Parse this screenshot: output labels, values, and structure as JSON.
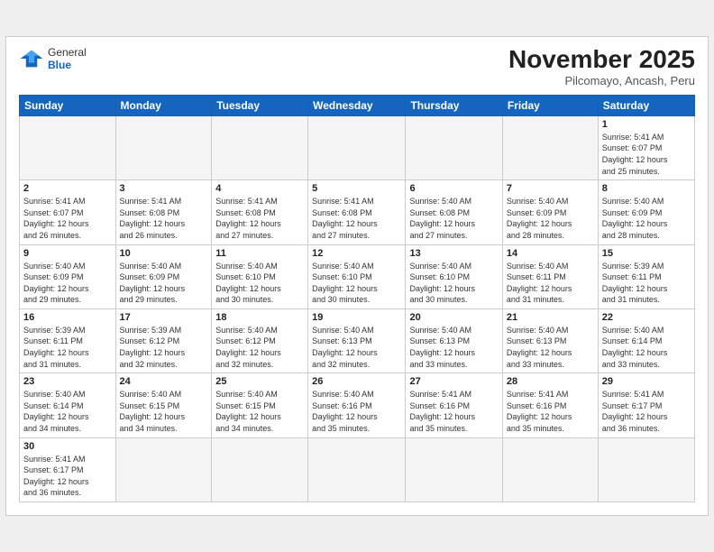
{
  "header": {
    "logo_general": "General",
    "logo_blue": "Blue",
    "month_title": "November 2025",
    "subtitle": "Pilcomayo, Ancash, Peru"
  },
  "weekdays": [
    "Sunday",
    "Monday",
    "Tuesday",
    "Wednesday",
    "Thursday",
    "Friday",
    "Saturday"
  ],
  "weeks": [
    [
      {
        "day": "",
        "info": ""
      },
      {
        "day": "",
        "info": ""
      },
      {
        "day": "",
        "info": ""
      },
      {
        "day": "",
        "info": ""
      },
      {
        "day": "",
        "info": ""
      },
      {
        "day": "",
        "info": ""
      },
      {
        "day": "1",
        "info": "Sunrise: 5:41 AM\nSunset: 6:07 PM\nDaylight: 12 hours\nand 25 minutes."
      }
    ],
    [
      {
        "day": "2",
        "info": "Sunrise: 5:41 AM\nSunset: 6:07 PM\nDaylight: 12 hours\nand 26 minutes."
      },
      {
        "day": "3",
        "info": "Sunrise: 5:41 AM\nSunset: 6:08 PM\nDaylight: 12 hours\nand 26 minutes."
      },
      {
        "day": "4",
        "info": "Sunrise: 5:41 AM\nSunset: 6:08 PM\nDaylight: 12 hours\nand 27 minutes."
      },
      {
        "day": "5",
        "info": "Sunrise: 5:41 AM\nSunset: 6:08 PM\nDaylight: 12 hours\nand 27 minutes."
      },
      {
        "day": "6",
        "info": "Sunrise: 5:40 AM\nSunset: 6:08 PM\nDaylight: 12 hours\nand 27 minutes."
      },
      {
        "day": "7",
        "info": "Sunrise: 5:40 AM\nSunset: 6:09 PM\nDaylight: 12 hours\nand 28 minutes."
      },
      {
        "day": "8",
        "info": "Sunrise: 5:40 AM\nSunset: 6:09 PM\nDaylight: 12 hours\nand 28 minutes."
      }
    ],
    [
      {
        "day": "9",
        "info": "Sunrise: 5:40 AM\nSunset: 6:09 PM\nDaylight: 12 hours\nand 29 minutes."
      },
      {
        "day": "10",
        "info": "Sunrise: 5:40 AM\nSunset: 6:09 PM\nDaylight: 12 hours\nand 29 minutes."
      },
      {
        "day": "11",
        "info": "Sunrise: 5:40 AM\nSunset: 6:10 PM\nDaylight: 12 hours\nand 30 minutes."
      },
      {
        "day": "12",
        "info": "Sunrise: 5:40 AM\nSunset: 6:10 PM\nDaylight: 12 hours\nand 30 minutes."
      },
      {
        "day": "13",
        "info": "Sunrise: 5:40 AM\nSunset: 6:10 PM\nDaylight: 12 hours\nand 30 minutes."
      },
      {
        "day": "14",
        "info": "Sunrise: 5:40 AM\nSunset: 6:11 PM\nDaylight: 12 hours\nand 31 minutes."
      },
      {
        "day": "15",
        "info": "Sunrise: 5:39 AM\nSunset: 6:11 PM\nDaylight: 12 hours\nand 31 minutes."
      }
    ],
    [
      {
        "day": "16",
        "info": "Sunrise: 5:39 AM\nSunset: 6:11 PM\nDaylight: 12 hours\nand 31 minutes."
      },
      {
        "day": "17",
        "info": "Sunrise: 5:39 AM\nSunset: 6:12 PM\nDaylight: 12 hours\nand 32 minutes."
      },
      {
        "day": "18",
        "info": "Sunrise: 5:40 AM\nSunset: 6:12 PM\nDaylight: 12 hours\nand 32 minutes."
      },
      {
        "day": "19",
        "info": "Sunrise: 5:40 AM\nSunset: 6:13 PM\nDaylight: 12 hours\nand 32 minutes."
      },
      {
        "day": "20",
        "info": "Sunrise: 5:40 AM\nSunset: 6:13 PM\nDaylight: 12 hours\nand 33 minutes."
      },
      {
        "day": "21",
        "info": "Sunrise: 5:40 AM\nSunset: 6:13 PM\nDaylight: 12 hours\nand 33 minutes."
      },
      {
        "day": "22",
        "info": "Sunrise: 5:40 AM\nSunset: 6:14 PM\nDaylight: 12 hours\nand 33 minutes."
      }
    ],
    [
      {
        "day": "23",
        "info": "Sunrise: 5:40 AM\nSunset: 6:14 PM\nDaylight: 12 hours\nand 34 minutes."
      },
      {
        "day": "24",
        "info": "Sunrise: 5:40 AM\nSunset: 6:15 PM\nDaylight: 12 hours\nand 34 minutes."
      },
      {
        "day": "25",
        "info": "Sunrise: 5:40 AM\nSunset: 6:15 PM\nDaylight: 12 hours\nand 34 minutes."
      },
      {
        "day": "26",
        "info": "Sunrise: 5:40 AM\nSunset: 6:16 PM\nDaylight: 12 hours\nand 35 minutes."
      },
      {
        "day": "27",
        "info": "Sunrise: 5:41 AM\nSunset: 6:16 PM\nDaylight: 12 hours\nand 35 minutes."
      },
      {
        "day": "28",
        "info": "Sunrise: 5:41 AM\nSunset: 6:16 PM\nDaylight: 12 hours\nand 35 minutes."
      },
      {
        "day": "29",
        "info": "Sunrise: 5:41 AM\nSunset: 6:17 PM\nDaylight: 12 hours\nand 36 minutes."
      }
    ],
    [
      {
        "day": "30",
        "info": "Sunrise: 5:41 AM\nSunset: 6:17 PM\nDaylight: 12 hours\nand 36 minutes."
      },
      {
        "day": "",
        "info": ""
      },
      {
        "day": "",
        "info": ""
      },
      {
        "day": "",
        "info": ""
      },
      {
        "day": "",
        "info": ""
      },
      {
        "day": "",
        "info": ""
      },
      {
        "day": "",
        "info": ""
      }
    ]
  ]
}
